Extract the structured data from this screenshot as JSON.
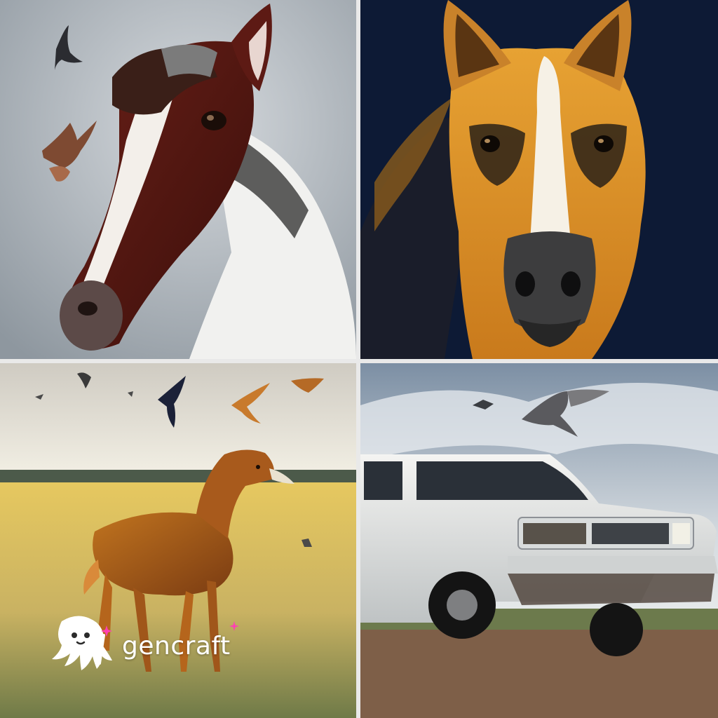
{
  "watermark": {
    "brand": "gencraft",
    "icon": "octopus-logo-icon",
    "colors": {
      "text": "#ffffff",
      "sparkle": "#ff3fb4"
    }
  },
  "panels": [
    {
      "id": "horse-portrait",
      "background": "#b8bec4"
    },
    {
      "id": "dog-horse-portrait",
      "background": "#0d1a35"
    },
    {
      "id": "bird-horse-field",
      "background": "#e8e3d6"
    },
    {
      "id": "white-suv",
      "background": "#9aa8b6"
    }
  ]
}
